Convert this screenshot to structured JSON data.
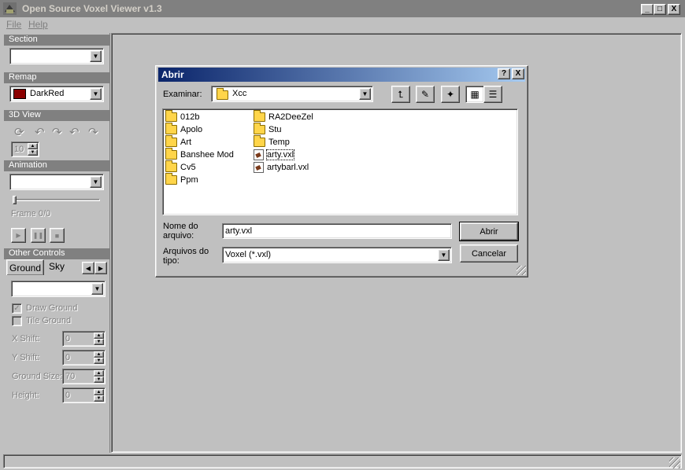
{
  "app": {
    "title": "Open Source Voxel Viewer v1.3",
    "menu": [
      "File",
      "Help"
    ],
    "controls": {
      "minimize": "_",
      "maximize": "□",
      "close": "X"
    }
  },
  "sidebar": {
    "section": {
      "header": "Section",
      "value": ""
    },
    "remap": {
      "header": "Remap",
      "value": "DarkRed",
      "swatch": "#8b0000"
    },
    "view3d": {
      "header": "3D View",
      "spin_value": "10"
    },
    "animation": {
      "header": "Animation",
      "value": "",
      "frame_label": "Frame 0/0"
    },
    "other": {
      "header": "Other Controls",
      "tabs": [
        "Ground",
        "Sky"
      ],
      "combo_value": "",
      "draw_ground": "Draw Ground",
      "tile_ground": "Tile Ground",
      "x_shift": {
        "label": "X Shift:",
        "value": "0"
      },
      "y_shift": {
        "label": "Y Shift:",
        "value": "0"
      },
      "ground_size": {
        "label": "Ground Size:",
        "value": "70"
      },
      "height": {
        "label": "Height:",
        "value": "0"
      }
    }
  },
  "dialog": {
    "title": "Abrir",
    "help": "?",
    "close": "X",
    "look_in_label": "Examinar:",
    "look_in_value": "Xcc",
    "files_col1": [
      {
        "name": "012b",
        "type": "folder"
      },
      {
        "name": "Apolo",
        "type": "folder"
      },
      {
        "name": "Art",
        "type": "folder"
      },
      {
        "name": "Banshee Mod",
        "type": "folder"
      },
      {
        "name": "Cv5",
        "type": "folder"
      },
      {
        "name": "Ppm",
        "type": "folder"
      }
    ],
    "files_col2": [
      {
        "name": "RA2DeeZel",
        "type": "folder"
      },
      {
        "name": "Stu",
        "type": "folder"
      },
      {
        "name": "Temp",
        "type": "folder"
      },
      {
        "name": "arty.vxl",
        "type": "file"
      },
      {
        "name": "artybarl.vxl",
        "type": "file"
      }
    ],
    "filename_label_1": "Nome do",
    "filename_label_2": "arquivo:",
    "filename_value": "arty.vxl",
    "filetype_label_1": "Arquivos do",
    "filetype_label_2": "tipo:",
    "filetype_value": "Voxel (*.vxl)",
    "open_button": "Abrir",
    "cancel_button": "Cancelar"
  }
}
